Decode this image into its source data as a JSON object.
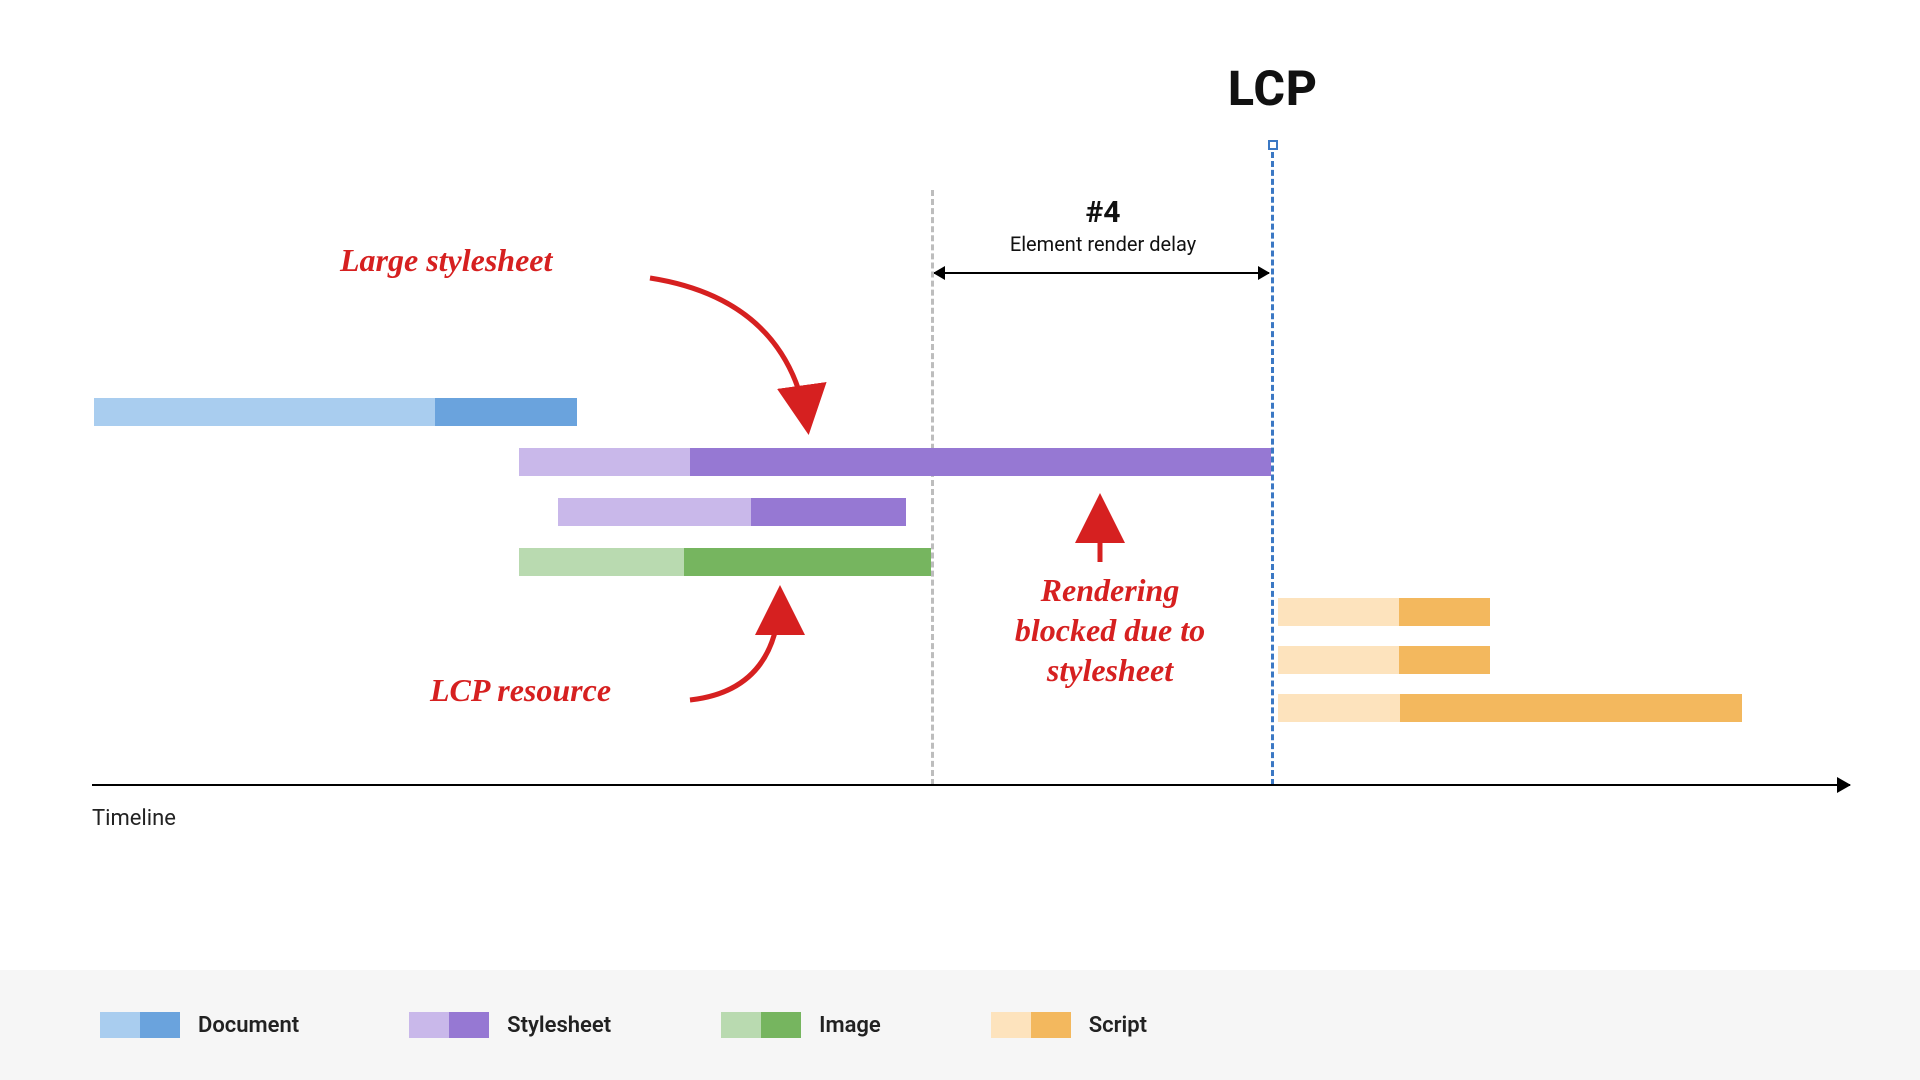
{
  "chart_data": {
    "type": "timeline-waterfall",
    "x_range": [
      0,
      100
    ],
    "axis_label": "Timeline",
    "lcp_marker": {
      "label": "LCP",
      "x": 66
    },
    "dashed_guides": [
      {
        "id": "gap-start",
        "x": 48.3,
        "color": "#bdbdbd"
      },
      {
        "id": "lcp-line",
        "x": 66,
        "color": "#3b78c4"
      }
    ],
    "segment_label": {
      "number": "#4",
      "text": "Element render delay",
      "from_x": 48.3,
      "to_x": 66
    },
    "tracks": [
      {
        "id": "document",
        "type": "Document",
        "start": 3,
        "split": 20.7,
        "end": 28,
        "row": 0
      },
      {
        "id": "stylesheet1",
        "type": "Stylesheet",
        "start": 25,
        "split": 34.3,
        "end": 66,
        "row": 1
      },
      {
        "id": "stylesheet2",
        "type": "Stylesheet",
        "start": 27,
        "split": 37,
        "end": 45,
        "row": 2
      },
      {
        "id": "image",
        "type": "Image",
        "start": 25,
        "split": 34.3,
        "end": 48.3,
        "row": 3
      },
      {
        "id": "script1",
        "type": "Script",
        "start": 66,
        "split": 72.3,
        "end": 77,
        "row": 4
      },
      {
        "id": "script2",
        "type": "Script",
        "start": 66,
        "split": 72.3,
        "end": 77,
        "row": 5
      },
      {
        "id": "script3",
        "type": "Script",
        "start": 66,
        "split": 72.3,
        "end": 90,
        "row": 6
      }
    ],
    "annotations": [
      {
        "id": "large-stylesheet",
        "text": "Large stylesheet",
        "target_track": "stylesheet1"
      },
      {
        "id": "lcp-resource",
        "text": "LCP resource",
        "target_track": "image"
      },
      {
        "id": "blocked",
        "text": "Rendering\nblocked due to\nstylesheet",
        "target_track": "stylesheet1"
      }
    ]
  },
  "colors": {
    "Document": {
      "light": "#a9cdef",
      "dark": "#6aa3dd"
    },
    "Stylesheet": {
      "light": "#c9b8ea",
      "dark": "#9678d3"
    },
    "Image": {
      "light": "#b9dab0",
      "dark": "#76b55f"
    },
    "Script": {
      "light": "#fde3bd",
      "dark": "#f3b85e"
    }
  },
  "legend": [
    {
      "type": "Document",
      "label": "Document"
    },
    {
      "type": "Stylesheet",
      "label": "Stylesheet"
    },
    {
      "type": "Image",
      "label": "Image"
    },
    {
      "type": "Script",
      "label": "Script"
    }
  ]
}
